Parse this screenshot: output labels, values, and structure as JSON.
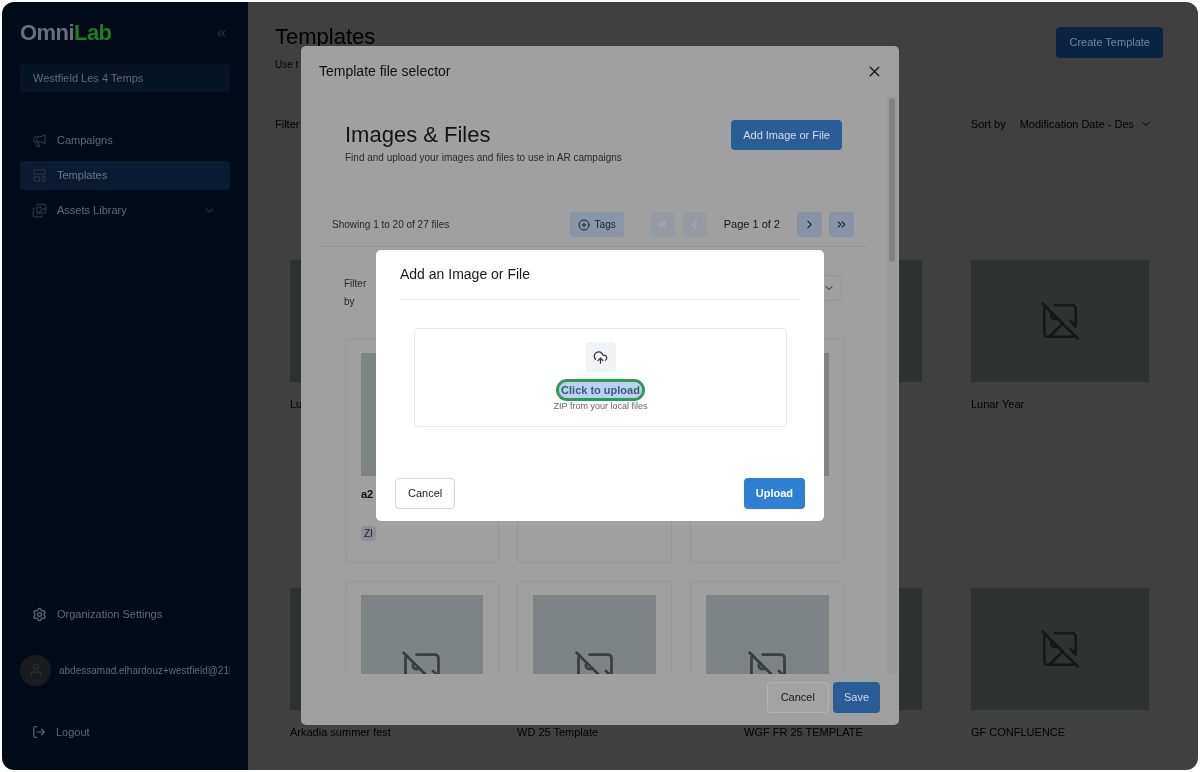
{
  "sidebar": {
    "logo": [
      {
        "text": "Omni",
        "kind": "plain"
      },
      {
        "text": "Lab",
        "kind": "accent"
      }
    ],
    "account": "Westfield Les 4 Temps",
    "nav": [
      {
        "label": "Campaigns",
        "kind": "campaigns",
        "selected": false,
        "expandable": false
      },
      {
        "label": "Templates",
        "kind": "templates",
        "selected": true,
        "expandable": false
      },
      {
        "label": "Assets Library",
        "kind": "assets",
        "selected": false,
        "expandable": true
      }
    ],
    "settings": "Organization Settings",
    "user": "abdessamad.elhardouz+westfield@21l",
    "logout": "Logout"
  },
  "page": {
    "title": "Templates",
    "subtitle": "Use t",
    "create_button": "Create Template",
    "filter_label": "Filter",
    "sort_label": "Sort by",
    "sort_value": "Modification Date - Des",
    "templates": [
      {
        "kind": "covered",
        "title": "Lu"
      },
      {
        "kind": "covered"
      },
      {
        "kind": "covered"
      },
      {
        "kind": "card",
        "title": "Lunar Year"
      },
      {
        "kind": "covered",
        "title": "Arkadia summer fest"
      },
      {
        "kind": "title_only",
        "title": "WD 25 Template"
      },
      {
        "kind": "covered",
        "title": "WGF FR 25 TEMPLATE"
      },
      {
        "kind": "card",
        "title": "GF CONFLUENCE"
      }
    ]
  },
  "file_selector": {
    "title": "Template file selector",
    "heading": "Images & Files",
    "subtitle": "Find and upload your images and files to use in AR campaigns",
    "add_button": "Add Image or File",
    "count": "Showing 1 to 20 of 27 files",
    "tags_button": "Tags",
    "pager": [
      {
        "kind": "first",
        "disabled": true
      },
      {
        "kind": "prev",
        "disabled": true
      },
      {
        "kind": "label",
        "text": "Page 1 of 2"
      },
      {
        "kind": "next",
        "disabled": false
      },
      {
        "kind": "last",
        "disabled": false
      }
    ],
    "filter_label": "Filter by",
    "files": [
      {
        "kind": "file",
        "name": "a2",
        "tag": "ZI"
      },
      {
        "kind": "frame"
      },
      {
        "kind": "file"
      },
      {
        "kind": "file"
      },
      {
        "kind": "file"
      },
      {
        "kind": "file"
      }
    ],
    "cancel_button": "Cancel",
    "save_button": "Save"
  },
  "upload_dialog": {
    "title": "Add an Image or File",
    "link": "Click to upload",
    "highlighted": true,
    "hint": "ZIP from your local files",
    "cancel_button": "Cancel",
    "upload_button": "Upload"
  }
}
